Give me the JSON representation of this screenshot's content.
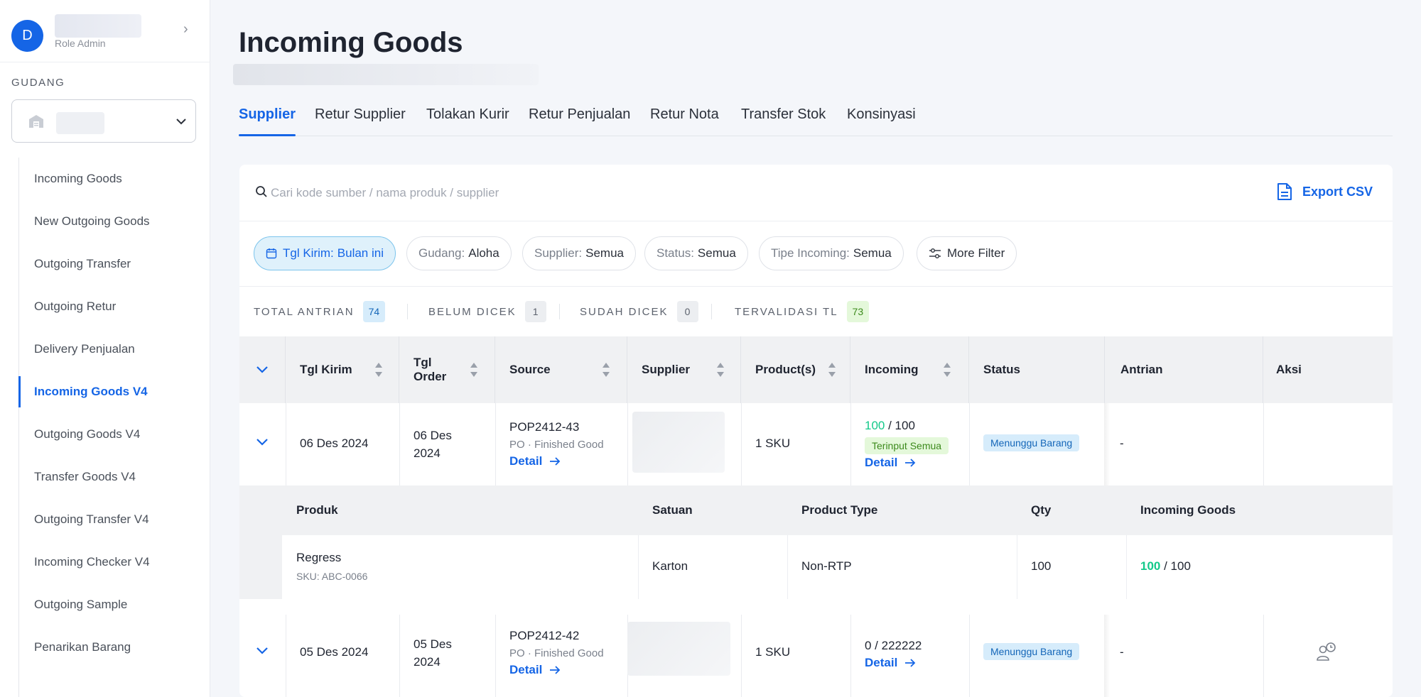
{
  "sidebar": {
    "avatar_letter": "D",
    "user_role": "Role Admin",
    "gudang_label": "GUDANG",
    "items": [
      {
        "label": "Incoming Goods"
      },
      {
        "label": "New Outgoing Goods"
      },
      {
        "label": "Outgoing Transfer"
      },
      {
        "label": "Outgoing Retur"
      },
      {
        "label": "Delivery Penjualan"
      },
      {
        "label": "Incoming Goods V4",
        "active": true
      },
      {
        "label": "Outgoing Goods V4"
      },
      {
        "label": "Transfer Goods V4"
      },
      {
        "label": "Outgoing Transfer V4"
      },
      {
        "label": "Incoming Checker V4"
      },
      {
        "label": "Outgoing Sample"
      },
      {
        "label": "Penarikan Barang"
      }
    ]
  },
  "page": {
    "title": "Incoming Goods"
  },
  "tabs": [
    {
      "label": "Supplier",
      "active": true
    },
    {
      "label": "Retur Supplier"
    },
    {
      "label": "Tolakan Kurir"
    },
    {
      "label": "Retur Penjualan"
    },
    {
      "label": "Retur Nota"
    },
    {
      "label": "Transfer Stok"
    },
    {
      "label": "Konsinyasi"
    }
  ],
  "search": {
    "placeholder": "Cari kode sumber / nama produk / supplier",
    "value": ""
  },
  "export_label": "Export CSV",
  "filters": [
    {
      "label": "Tgl Kirim:",
      "value": "Bulan ini",
      "active": true
    },
    {
      "label": "Gudang:",
      "value": "Aloha"
    },
    {
      "label": "Supplier:",
      "value": "Semua"
    },
    {
      "label": "Status:",
      "value": "Semua"
    },
    {
      "label": "Tipe Incoming:",
      "value": "Semua"
    }
  ],
  "more_filter_label": "More Filter",
  "stats": [
    {
      "label": "TOTAL ANTRIAN",
      "count": "74",
      "badge_bg": "#d6ecfb",
      "badge_fg": "#1466b8"
    },
    {
      "label": "BELUM DICEK",
      "count": "1",
      "badge_bg": "#eceef1",
      "badge_fg": "#5c626d"
    },
    {
      "label": "SUDAH DICEK",
      "count": "0",
      "badge_bg": "#eceef1",
      "badge_fg": "#5c626d"
    },
    {
      "label": "TERVALIDASI TL",
      "count": "73",
      "badge_bg": "#e4f8da",
      "badge_fg": "#3c8a1c"
    }
  ],
  "table": {
    "headers": {
      "tgl_kirim": "Tgl Kirim",
      "tgl_order_1": "Tgl",
      "tgl_order_2": "Order",
      "source": "Source",
      "supplier": "Supplier",
      "products": "Product(s)",
      "incoming": "Incoming",
      "status": "Status",
      "antrian": "Antrian",
      "aksi": "Aksi"
    },
    "rows": [
      {
        "tgl_kirim": "06 Des 2024",
        "tgl_order_1": "06 Des",
        "tgl_order_2": "2024",
        "source_code": "POP2412-43",
        "source_type": "PO · Finished Good",
        "detail_label": "Detail",
        "products": "1 SKU",
        "incoming_done": "100",
        "incoming_total": "/ 100",
        "incoming_badge": "Terinput Semua",
        "status": "Menunggu Barang",
        "antrian": "-"
      },
      {
        "tgl_kirim": "05 Des 2024",
        "tgl_order_1": "05 Des",
        "tgl_order_2": "2024",
        "source_code": "POP2412-42",
        "source_type": "PO · Finished Good",
        "detail_label": "Detail",
        "products": "1 SKU",
        "incoming_text": "0 / 222222",
        "status": "Menunggu Barang",
        "antrian": "-"
      }
    ],
    "sub_headers": {
      "produk": "Produk",
      "satuan": "Satuan",
      "product_type": "Product Type",
      "qty": "Qty",
      "incoming_goods": "Incoming Goods"
    },
    "sub_row": {
      "produk": "Regress",
      "sku": "SKU: ABC-0066",
      "satuan": "Karton",
      "product_type": "Non-RTP",
      "qty": "100",
      "incoming_done": "100",
      "incoming_total": "/ 100"
    }
  },
  "colors": {
    "accent": "#1565e6",
    "success": "#14c98a"
  }
}
